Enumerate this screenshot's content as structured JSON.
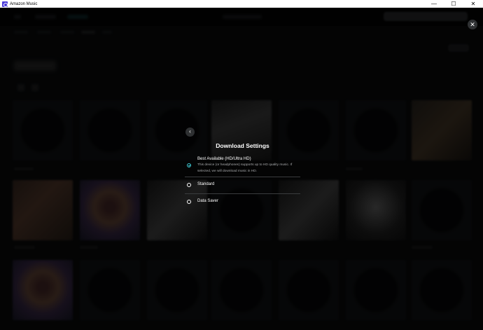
{
  "window": {
    "title": "Amazon Music",
    "controls": {
      "minimize": "—",
      "maximize": "☐",
      "close": "✕"
    }
  },
  "overlay": {
    "close_glyph": "✕",
    "back_glyph": "‹"
  },
  "dialog": {
    "title": "Download Settings",
    "options": [
      {
        "label": "Best Available (HD/Ultra HD)",
        "description": "This device (or headphones) supports up to HD quality music. If selected, we will download music in HD.",
        "selected": true
      },
      {
        "label": "Standard",
        "selected": false
      },
      {
        "label": "Data Saver",
        "selected": false
      }
    ]
  },
  "colors": {
    "accent": "#3ec6d0",
    "background": "#000000",
    "titlebar": "#ffffff",
    "app_icon": "#4a3ad8"
  },
  "icons": {
    "app": "amazon-music-icon",
    "close": "close-icon",
    "back": "chevron-left-icon",
    "selected": "check-circle-icon",
    "unselected": "radio-empty-icon"
  }
}
